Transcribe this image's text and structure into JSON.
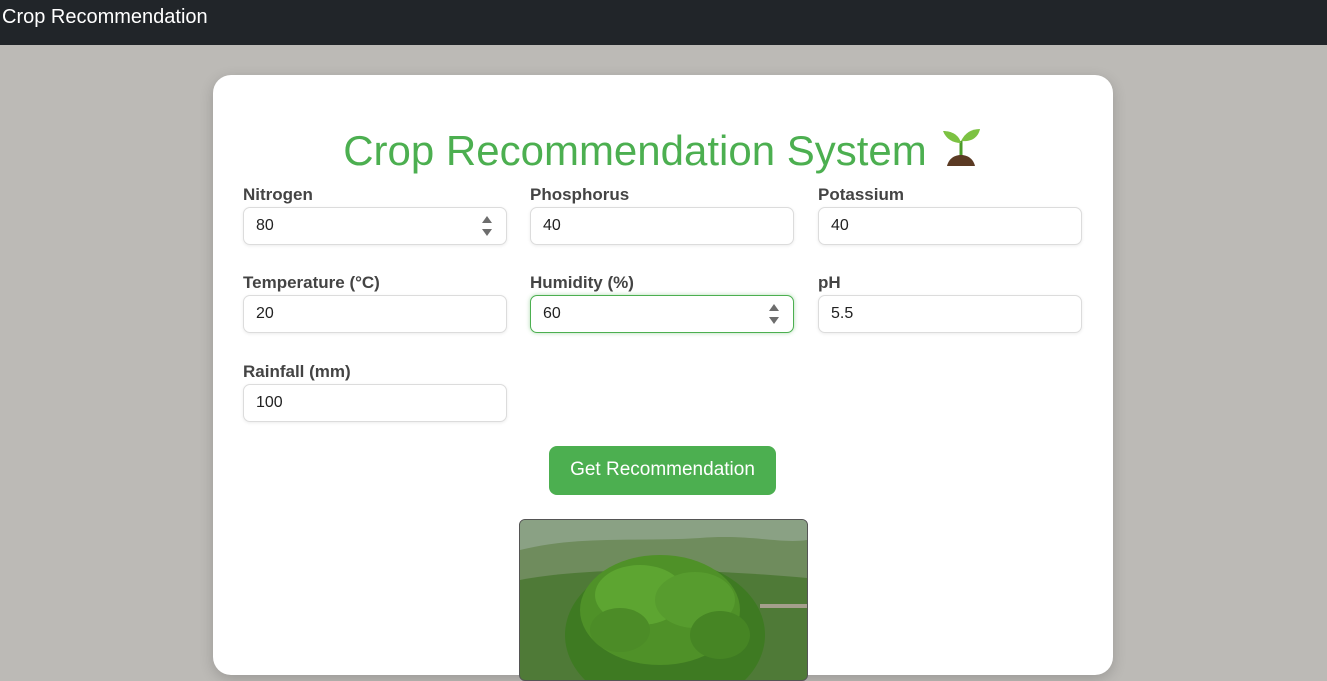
{
  "navbar": {
    "brand": "Crop Recommendation"
  },
  "main": {
    "title": "Crop Recommendation System",
    "title_icon": "seedling-icon",
    "accent_color": "#4caf50",
    "fields": [
      {
        "id": "nitrogen",
        "label": "Nitrogen",
        "value": "80"
      },
      {
        "id": "phosphorus",
        "label": "Phosphorus",
        "value": "40"
      },
      {
        "id": "potassium",
        "label": "Potassium",
        "value": "40"
      },
      {
        "id": "temperature",
        "label": "Temperature (°C)",
        "value": "20"
      },
      {
        "id": "humidity",
        "label": "Humidity (%)",
        "value": "60"
      },
      {
        "id": "ph",
        "label": "pH",
        "value": "5.5"
      },
      {
        "id": "rainfall",
        "label": "Rainfall (mm)",
        "value": "100"
      }
    ],
    "submit_label": "Get Recommendation"
  }
}
